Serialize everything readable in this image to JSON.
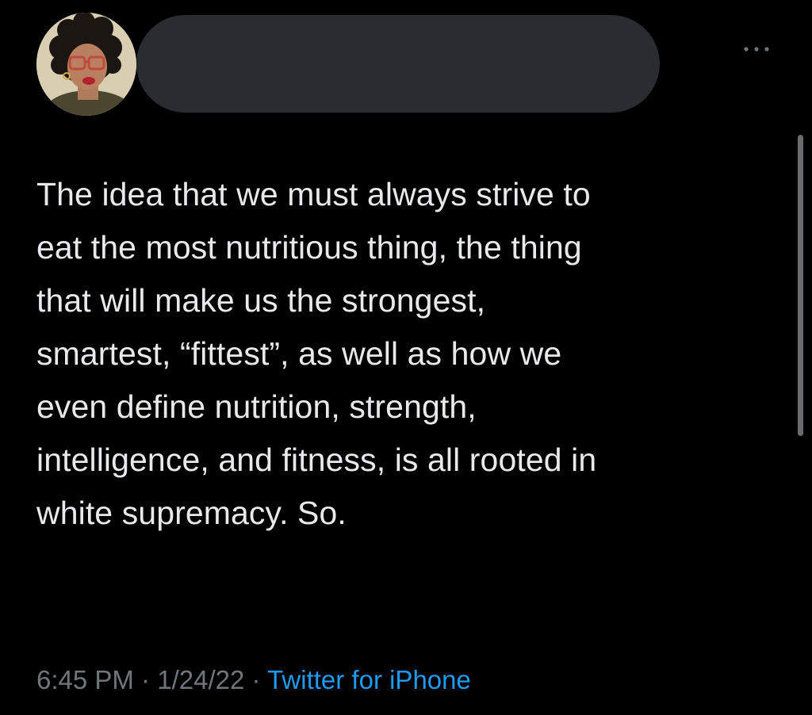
{
  "tweet": {
    "text_lines": [
      "The idea that we must always strive to",
      "eat the most nutritious thing, the thing",
      "that will make us the strongest,",
      "smartest, “fittest”, as well as how we",
      "even define nutrition, strength,",
      "intelligence, and fitness, is all rooted in",
      "white supremacy. So."
    ],
    "time": "6:45 PM",
    "separator": " · ",
    "date": "1/24/22",
    "source": "Twitter for iPhone"
  },
  "icons": {
    "more": "more-horizontal-icon"
  },
  "colors": {
    "background": "#000000",
    "text": "#e7e9ea",
    "meta": "#71767b",
    "link": "#1d9bf0",
    "redaction": "#292c31"
  }
}
